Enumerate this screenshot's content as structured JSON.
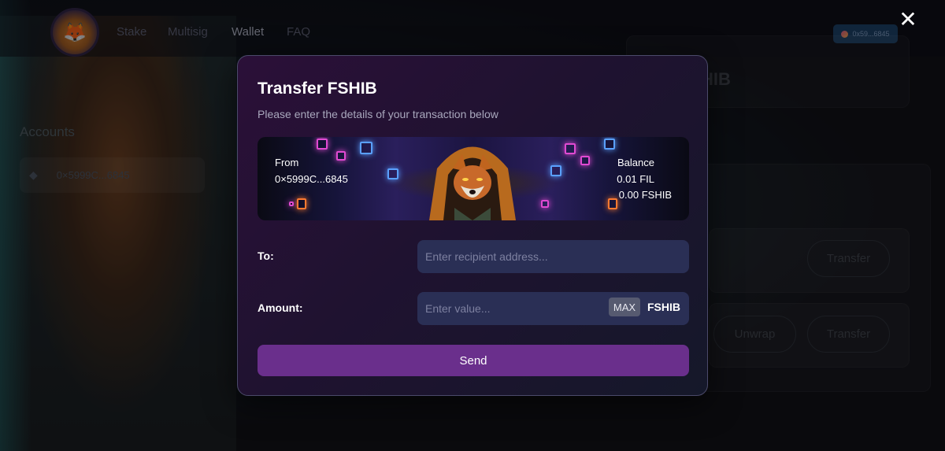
{
  "nav": {
    "links": [
      "Stake",
      "Multisig",
      "Wallet",
      "FAQ"
    ],
    "active": "Wallet",
    "wallet_address": "0x59...6845"
  },
  "sidebar": {
    "title": "Accounts",
    "account": "0×5999C...6845"
  },
  "background": {
    "token_symbol_partial": "HIB",
    "buttons": [
      "Transfer",
      "Unwrap",
      "Transfer"
    ]
  },
  "modal": {
    "title": "Transfer FSHIB",
    "subtitle": "Please enter the details of your transaction below",
    "from_label": "From",
    "from_address": "0×5999C...6845",
    "balance_label": "Balance",
    "balance_fil": "0.01 FIL",
    "balance_fshib": "0.00 FSHIB",
    "to_label": "To:",
    "to_placeholder": "Enter recipient address...",
    "amount_label": "Amount:",
    "amount_placeholder": "Enter value...",
    "max_label": "MAX",
    "unit": "FSHIB",
    "send_label": "Send"
  },
  "colors": {
    "accent": "#6a2f8c",
    "input_bg": "#2a2f55"
  },
  "icons": {
    "close": "close-icon",
    "logo": "shiba-logo-icon",
    "chain": "ethereum-icon"
  }
}
